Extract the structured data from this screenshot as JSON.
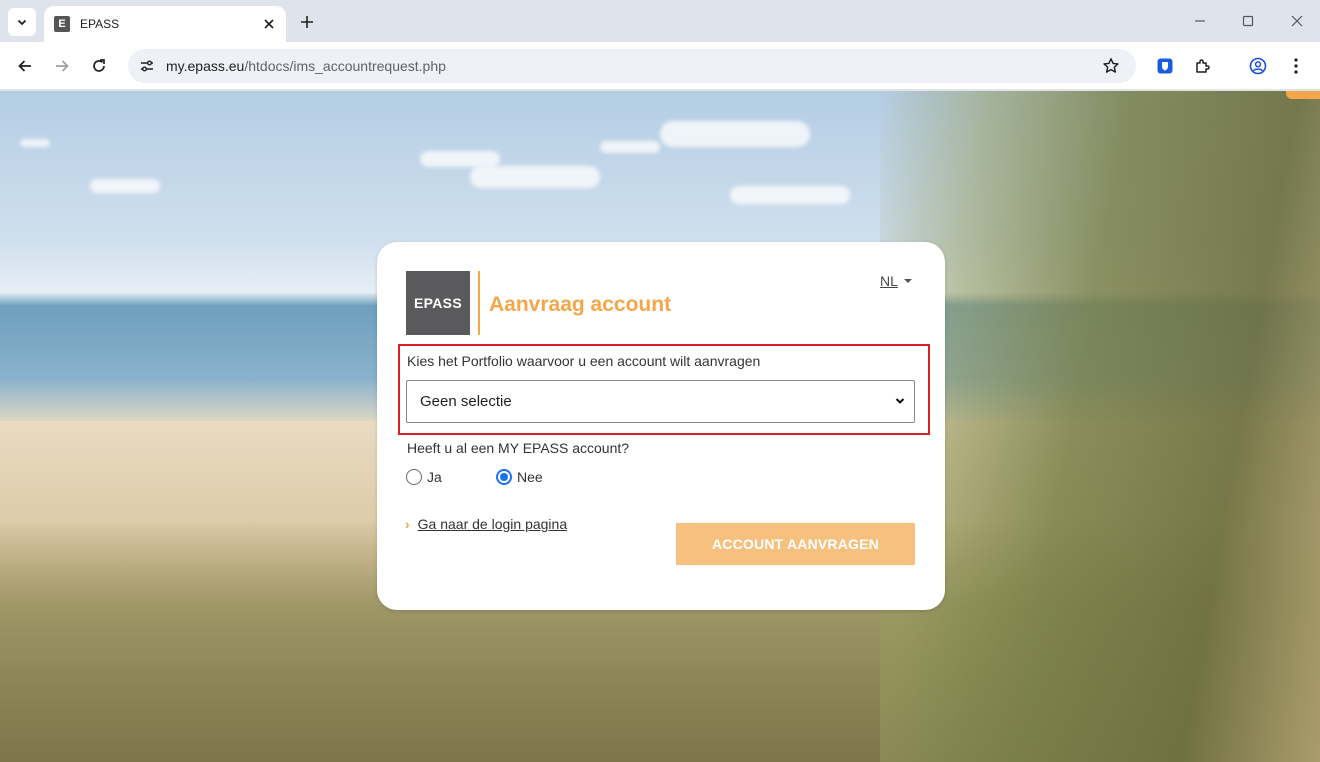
{
  "browser": {
    "tab_title": "EPASS",
    "tab_favicon_letter": "E",
    "url_host": "my.epass.eu",
    "url_path": "/htdocs/ims_accountrequest.php"
  },
  "card": {
    "logo_text": "EPASS",
    "title": "Aanvraag account",
    "language": "NL",
    "portfolio_label": "Kies het Portfolio waarvoor u een account wilt aanvragen",
    "portfolio_selected": "Geen selectie",
    "question": "Heeft u al een MY EPASS account?",
    "radio_yes_label": "Ja",
    "radio_no_label": "Nee",
    "radio_selected": "Nee",
    "login_link": "Ga naar de login pagina",
    "submit_label": "ACCOUNT AANVRAGEN"
  },
  "colors": {
    "accent_orange": "#f4a64a",
    "button_orange": "#f6c07e",
    "logo_gray": "#5a5a5c",
    "highlight_red": "#d9202a",
    "radio_blue": "#1a73e8"
  },
  "icons": {
    "tab_search": "chevron-down-icon",
    "tab_close": "close-icon",
    "new_tab": "plus-icon",
    "back": "arrow-left-icon",
    "forward": "arrow-right-icon",
    "reload": "reload-icon",
    "site_info": "tune-icon",
    "bookmark": "star-icon",
    "password_manager": "shield-icon",
    "extensions": "puzzle-icon",
    "profile": "account-circle-icon",
    "menu": "more-vert-icon"
  }
}
